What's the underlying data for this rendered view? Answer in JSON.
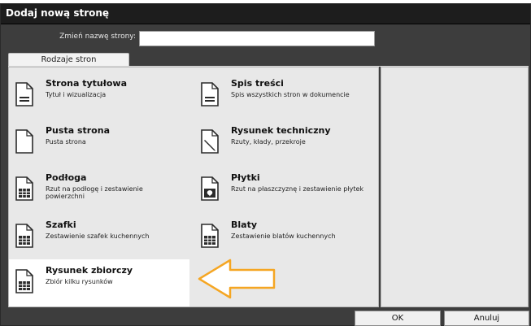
{
  "dialog": {
    "title": "Dodaj nową stronę",
    "rename_label": "Zmień nazwę strony:",
    "rename_value": ""
  },
  "tabs": [
    {
      "label": "Rodzaje stron"
    }
  ],
  "page_types": [
    {
      "title": "Strona tytułowa",
      "desc": "Tytuł i wizualizacja",
      "icon": "document-lines-icon"
    },
    {
      "title": "Spis treści",
      "desc": "Spis wszystkich stron w dokumencie",
      "icon": "document-lines-icon"
    },
    {
      "title": "Pusta strona",
      "desc": "Pusta strona",
      "icon": "document-blank-icon"
    },
    {
      "title": "Rysunek techniczny",
      "desc": "Rzuty, kłady, przekroje",
      "icon": "pencil-document-icon"
    },
    {
      "title": "Podłoga",
      "desc": "Rzut na podłogę i zestawienie powierzchni",
      "icon": "grid-document-icon"
    },
    {
      "title": "Płytki",
      "desc": "Rzut na płaszczyznę i zestawienie płytek",
      "icon": "tile-document-icon"
    },
    {
      "title": "Szafki",
      "desc": "Zestawienie szafek kuchennych",
      "icon": "grid-document-icon"
    },
    {
      "title": "Blaty",
      "desc": "Zestawienie blatów kuchennych",
      "icon": "grid-document-icon"
    },
    {
      "title": "Rysunek zbiorczy",
      "desc": "Zbiór kilku rysunków",
      "icon": "grid-document-icon"
    }
  ],
  "buttons": {
    "ok": "OK",
    "cancel": "Anuluj"
  },
  "colors": {
    "titlebar": "#1d1d1d",
    "dialog_bg": "#3d3d3d",
    "panel_bg": "#e8e8e8",
    "arrow_fill": "#ffffff",
    "arrow_stroke": "#f5a623"
  }
}
